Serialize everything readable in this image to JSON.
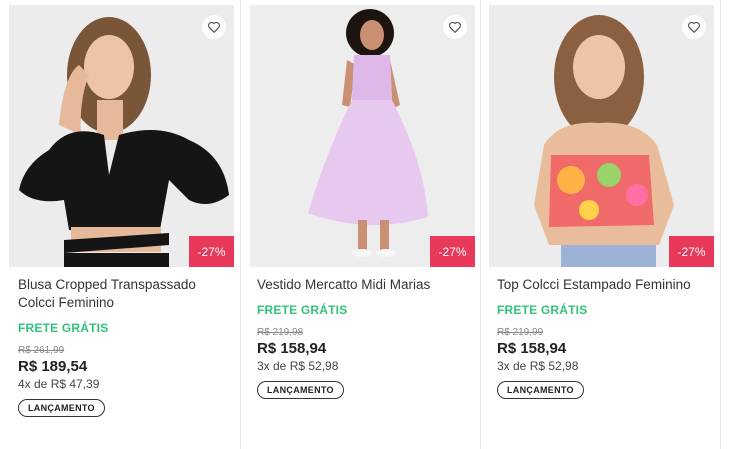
{
  "products": [
    {
      "title": "Blusa Cropped Transpassado Colcci Feminino",
      "shipping": "FRETE GRÁTIS",
      "old_price": "R$ 261,99",
      "price": "R$ 189,54",
      "installments": "4x de R$ 47,39",
      "discount": "-27%",
      "tag": "LANÇAMENTO",
      "favorite_icon": "heart-outline-icon"
    },
    {
      "title": "Vestido Mercatto Midi Marias",
      "shipping": "FRETE GRÁTIS",
      "old_price": "R$ 219,98",
      "price": "R$ 158,94",
      "installments": "3x de R$ 52,98",
      "discount": "-27%",
      "tag": "LANÇAMENTO",
      "favorite_icon": "heart-outline-icon"
    },
    {
      "title": "Top Colcci Estampado Feminino",
      "shipping": "FRETE GRÁTIS",
      "old_price": "R$ 219,99",
      "price": "R$ 158,94",
      "installments": "3x de R$ 52,98",
      "discount": "-27%",
      "tag": "LANÇAMENTO",
      "favorite_icon": "heart-outline-icon"
    }
  ],
  "colors": {
    "discount_badge": "#e8395b",
    "free_shipping": "#33c27a"
  }
}
